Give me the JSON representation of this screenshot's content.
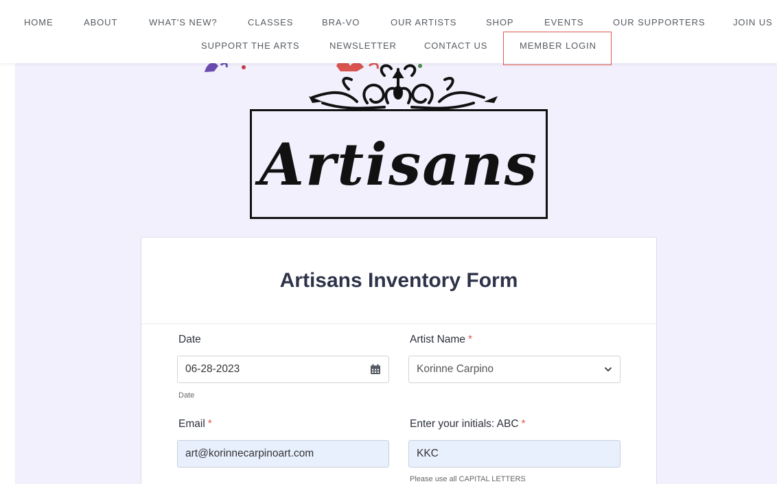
{
  "nav": {
    "row1": [
      "HOME",
      "ABOUT",
      "WHAT'S NEW?",
      "CLASSES",
      "BRA-VO",
      "OUR ARTISTS",
      "SHOP",
      "EVENTS",
      "OUR SUPPORTERS",
      "JOIN US"
    ],
    "row2": [
      "SUPPORT THE ARTS",
      "NEWSLETTER",
      "CONTACT US",
      "MEMBER LOGIN"
    ]
  },
  "logo": {
    "text": "Artisans"
  },
  "form": {
    "title": "Artisans Inventory Form",
    "date": {
      "label": "Date",
      "value": "06-28-2023",
      "help": "Date"
    },
    "artist": {
      "label": "Artist Name",
      "required": "*",
      "value": "Korinne Carpino"
    },
    "email": {
      "label": "Email",
      "required": "*",
      "value": "art@korinnecarpinoart.com"
    },
    "initials": {
      "label": "Enter your initials: ABC",
      "required": "*",
      "value": "KKC",
      "help": "Please use all CAPITAL LETTERS"
    }
  },
  "icons": {
    "calendar": "calendar-icon",
    "chevron": "chevron-down-icon"
  },
  "colors": {
    "accent": "#e0584c",
    "page_bg": "#f1f0fc",
    "autofill": "#e8f0fe"
  }
}
